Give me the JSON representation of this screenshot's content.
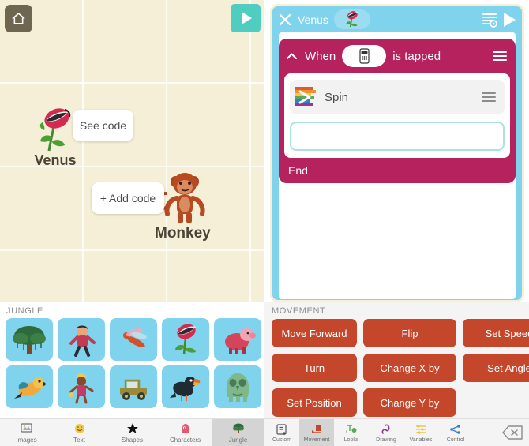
{
  "left_screen": {
    "home_button": {
      "icon": "home-icon"
    },
    "play_button": {
      "icon": "play-icon"
    },
    "characters": [
      {
        "name": "Venus",
        "icon": "venus-flytrap-sprite",
        "chip_label": "See code",
        "chip_action": "see-code"
      },
      {
        "name": "Monkey",
        "icon": "monkey-sprite",
        "chip_label": "+ Add code",
        "chip_action": "add-code"
      }
    ],
    "palette": {
      "title": "JUNGLE",
      "tiles": [
        {
          "name": "tree"
        },
        {
          "name": "jungle-boy"
        },
        {
          "name": "dragonfly"
        },
        {
          "name": "venus-flytrap"
        },
        {
          "name": "boar"
        },
        {
          "name": "parrot"
        },
        {
          "name": "dancer"
        },
        {
          "name": "jeep"
        },
        {
          "name": "toucan"
        },
        {
          "name": "green-monster"
        }
      ]
    },
    "tabs": [
      {
        "label": "Images",
        "icon": "images-icon",
        "active": false
      },
      {
        "label": "Text",
        "icon": "text-icon",
        "active": false
      },
      {
        "label": "Shapes",
        "icon": "shapes-icon",
        "active": false
      },
      {
        "label": "Characters",
        "icon": "characters-icon",
        "active": false
      },
      {
        "label": "Jungle",
        "icon": "jungle-tree-icon",
        "active": true
      }
    ]
  },
  "right_screen": {
    "header": {
      "close_icon": "close-icon",
      "title": "Venus",
      "sprite_icon": "venus-flytrap-sprite",
      "list_icon": "view-list-icon",
      "play_icon": "play-icon"
    },
    "script": {
      "when_block": {
        "collapse_icon": "chevron-up-icon",
        "prefix": "When",
        "device_icon": "device-icon",
        "suffix": "is tapped",
        "menu_icon": "hamburger-icon"
      },
      "blocks": [
        {
          "label": "Spin",
          "icon": "rainbow-block-icon",
          "menu_icon": "hamburger-icon"
        }
      ],
      "drop_slot": {
        "name": "empty-drop-slot"
      },
      "end_label": "End"
    },
    "palette": {
      "title": "MOVEMENT",
      "blocks": [
        "Move Forward",
        "Flip",
        "Set Speed",
        "Turn",
        "Change X by",
        "Set Angle",
        "Set Position",
        "Change Y by"
      ]
    },
    "tabs": [
      {
        "label": "Custom",
        "icon": "custom-icon",
        "active": false
      },
      {
        "label": "Movement",
        "icon": "movement-icon",
        "active": true
      },
      {
        "label": "Looks",
        "icon": "looks-icon",
        "active": false
      },
      {
        "label": "Drawing",
        "icon": "drawing-icon",
        "active": false
      },
      {
        "label": "Variables",
        "icon": "variables-icon",
        "active": false
      },
      {
        "label": "Control",
        "icon": "control-icon",
        "active": false
      }
    ],
    "delete_key": {
      "icon": "delete-backspace-icon"
    }
  },
  "colors": {
    "stage_bg": "#F5EFD8",
    "teal": "#4ECDC0",
    "sky": "#7FD3EC",
    "crimson": "#B5225E",
    "block_orange": "#C4462B",
    "home_brown": "#6E6651"
  }
}
